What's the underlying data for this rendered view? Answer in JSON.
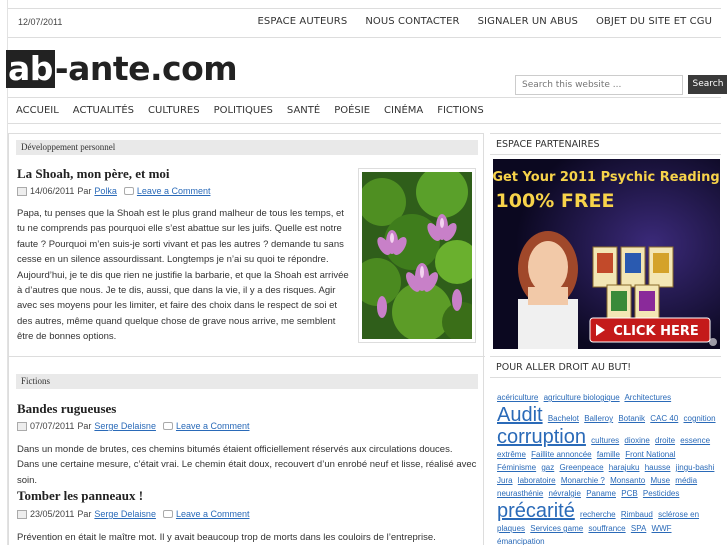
{
  "topbar": {
    "date": "12/07/2011",
    "nav": [
      "ESPACE AUTEURS",
      "NOUS CONTACTER",
      "SIGNALER UN ABUS",
      "OBJET DU SITE ET CGU"
    ]
  },
  "header": {
    "logo_box": "ab",
    "logo_rest": "-ante.com",
    "search_placeholder": "Search this website ...",
    "search_button": "Search"
  },
  "mainnav": [
    "ACCUEIL",
    "ACTUALITÉS",
    "CULTURES",
    "POLITIQUES",
    "SANTÉ",
    "POÉSIE",
    "CINÉMA",
    "FICTIONS"
  ],
  "posts": [
    {
      "category": "Développement personnel",
      "title": "La Shoah, mon père, et moi",
      "date": "14/06/2011",
      "by": "Par",
      "author": "Polka",
      "comment": "Leave a Comment",
      "excerpt": "Papa, tu penses que la Shoah est le plus grand malheur de tous les temps, et tu ne comprends pas pourquoi elle s’est abattue sur les juifs. Quelle est notre faute ? Pourquoi m’en suis-je sorti vivant et pas les autres ? demande tu sans cesse en un silence assourdissant. Longtemps je n’ai su quoi te répondre. Aujourd’hui, je te dis que rien ne justifie la barbarie, et que la Shoah est arrivée à d’autres que nous. Je te dis, aussi, que dans la vie, il y a des risques. Agir avec ses moyens pour les limiter, et faire des choix dans le respect de soi et des autres, même quand quelque chose de grave nous arrive, me semblent être de bonnes options."
    },
    {
      "category": "Fictions",
      "title": "Bandes rugueuses",
      "date": "07/07/2011",
      "by": "Par",
      "author": "Serge Delaisne",
      "comment": "Leave a Comment",
      "excerpt": "Dans un monde de brutes, ces chemins bitumés étaient officiellement réservés aux circulations douces. Dans une certaine mesure, c’était vrai. Le chemin était doux, recouvert d’un enrobé neuf et lisse, réalisé avec soin."
    },
    {
      "title": "Tomber les panneaux !",
      "date": "23/05/2011",
      "by": "Par",
      "author": "Serge Delaisne",
      "comment": "Leave a Comment",
      "excerpt": "Prévention en était le maître mot. Il y avait beaucoup trop de morts dans les couloirs de l’entreprise."
    }
  ],
  "sidebar": {
    "partners_title": "ESPACE PARTENAIRES",
    "ad": {
      "headline_1": "Get Your 2011 Psychic Reading",
      "headline_2": "100% FREE",
      "button": "CLICK HERE"
    },
    "tags_title": "POUR ALLER DROIT AU BUT!",
    "tags": [
      {
        "t": "acériculture",
        "s": 0
      },
      {
        "t": "agriculture biologique",
        "s": 0
      },
      {
        "t": "Architectures",
        "s": 0
      },
      {
        "t": "Audit",
        "s": 2
      },
      {
        "t": "Bachelot",
        "s": 0
      },
      {
        "t": "Balleroy",
        "s": 0
      },
      {
        "t": "Botanik",
        "s": 0
      },
      {
        "t": "CAC 40",
        "s": 0
      },
      {
        "t": "cognition",
        "s": 0
      },
      {
        "t": "corruption",
        "s": 2
      },
      {
        "t": "cultures",
        "s": 0
      },
      {
        "t": "dioxine",
        "s": 0
      },
      {
        "t": "droite",
        "s": 0
      },
      {
        "t": "essence",
        "s": 0
      },
      {
        "t": "extrême",
        "s": 0
      },
      {
        "t": "Faillite annoncée",
        "s": 0
      },
      {
        "t": "famille",
        "s": 0
      },
      {
        "t": "Front National",
        "s": 0
      },
      {
        "t": "Féminisme",
        "s": 0
      },
      {
        "t": "gaz",
        "s": 0
      },
      {
        "t": "Greenpeace",
        "s": 0
      },
      {
        "t": "harajuku",
        "s": 0
      },
      {
        "t": "hausse",
        "s": 0
      },
      {
        "t": "jingu-bashi",
        "s": 0
      },
      {
        "t": "Jura",
        "s": 0
      },
      {
        "t": "laboratoire",
        "s": 0
      },
      {
        "t": "Monarchie ?",
        "s": 0
      },
      {
        "t": "Monsanto",
        "s": 0
      },
      {
        "t": "Muse",
        "s": 0
      },
      {
        "t": "média",
        "s": 0
      },
      {
        "t": "neurasthénie",
        "s": 0
      },
      {
        "t": "névralgie",
        "s": 0
      },
      {
        "t": "Paname",
        "s": 0
      },
      {
        "t": "PCB",
        "s": 0
      },
      {
        "t": "Pesticides",
        "s": 0
      },
      {
        "t": "précarité",
        "s": 2
      },
      {
        "t": "recherche",
        "s": 0
      },
      {
        "t": "Rimbaud",
        "s": 0
      },
      {
        "t": "sclérose en",
        "s": 0
      },
      {
        "t": "plaques",
        "s": 0
      },
      {
        "t": "Services game",
        "s": 0
      },
      {
        "t": "souffrance",
        "s": 0
      },
      {
        "t": "SPA",
        "s": 0
      },
      {
        "t": "WWF",
        "s": 0
      },
      {
        "t": "émancipation",
        "s": 0
      }
    ]
  }
}
